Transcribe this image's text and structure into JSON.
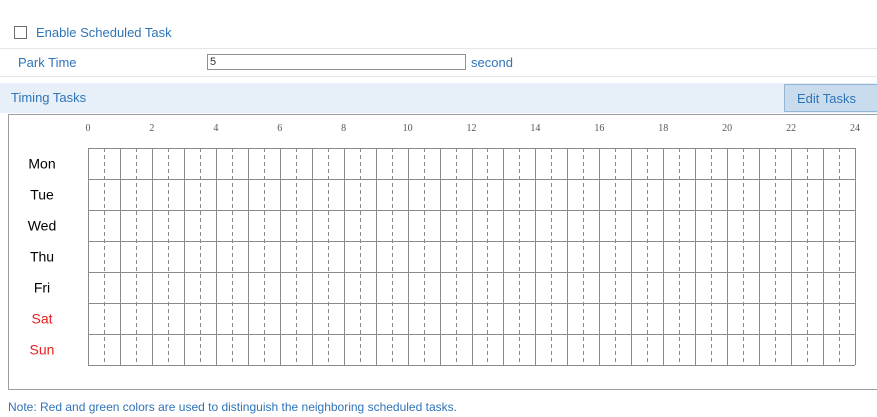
{
  "enable_task": {
    "label": "Enable Scheduled Task",
    "checked": false
  },
  "park_time": {
    "label": "Park Time",
    "value": "5",
    "unit": "second"
  },
  "timing": {
    "title": "Timing Tasks",
    "edit_button": "Edit Tasks"
  },
  "schedule": {
    "hour_ticks": [
      "0",
      "2",
      "4",
      "6",
      "8",
      "10",
      "12",
      "14",
      "16",
      "18",
      "20",
      "22",
      "24"
    ],
    "days": [
      {
        "label": "Mon",
        "color": "#000000"
      },
      {
        "label": "Tue",
        "color": "#000000"
      },
      {
        "label": "Wed",
        "color": "#000000"
      },
      {
        "label": "Thu",
        "color": "#000000"
      },
      {
        "label": "Fri",
        "color": "#000000"
      },
      {
        "label": "Sat",
        "color": "#e81f1f"
      },
      {
        "label": "Sun",
        "color": "#e81f1f"
      }
    ],
    "grid_color": "#8a8a8a"
  },
  "note": "Note: Red and green colors are used to distinguish the neighboring scheduled tasks."
}
